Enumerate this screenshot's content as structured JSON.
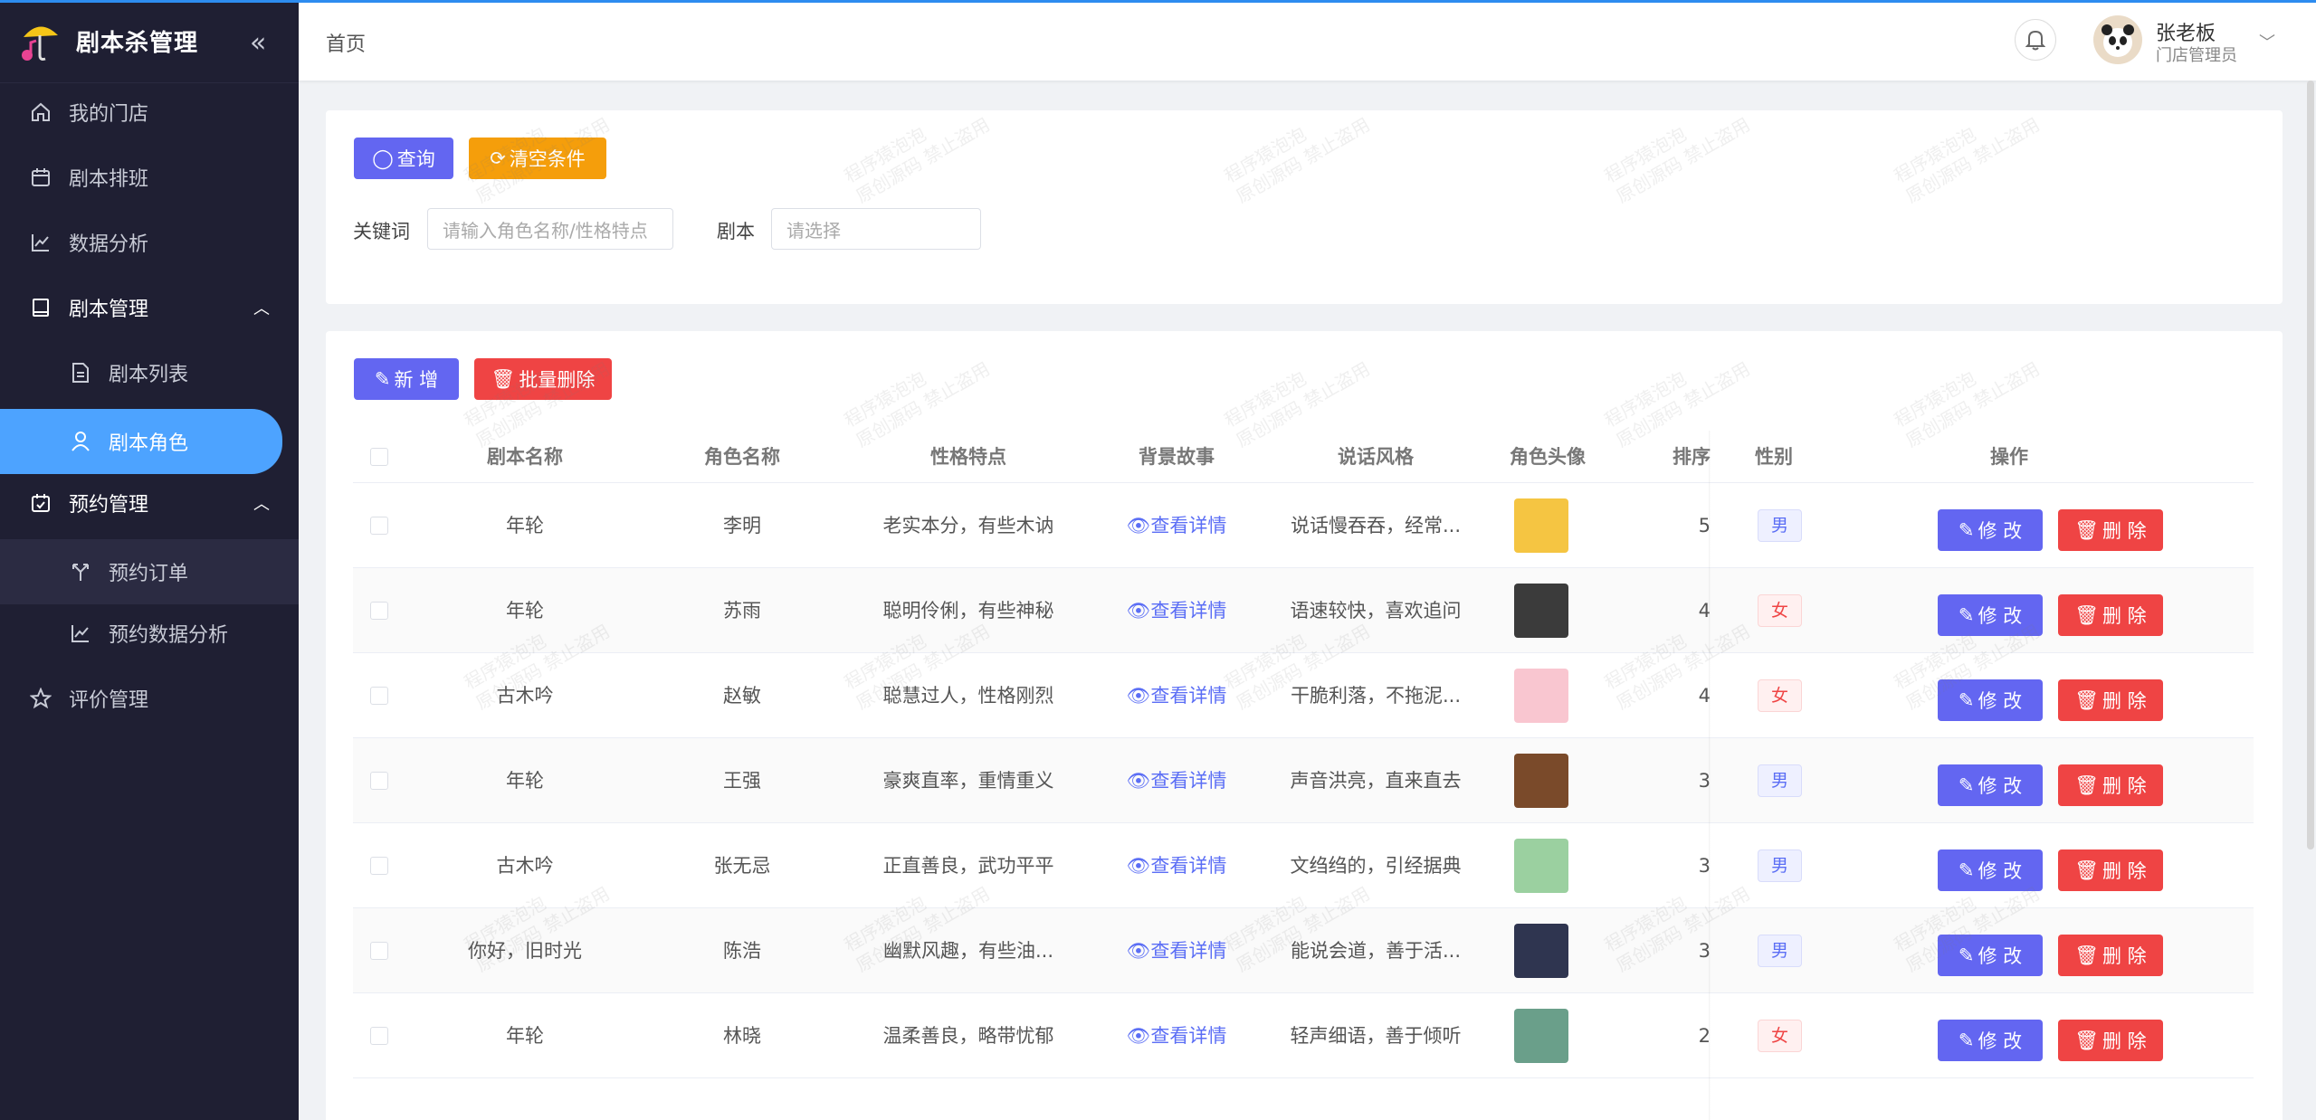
{
  "app": {
    "title": "剧本杀管理"
  },
  "sidebar": {
    "items": [
      {
        "label": "我的门店"
      },
      {
        "label": "剧本排班"
      },
      {
        "label": "数据分析"
      },
      {
        "label": "剧本管理"
      },
      {
        "label": "剧本列表"
      },
      {
        "label": "剧本角色"
      },
      {
        "label": "预约管理"
      },
      {
        "label": "预约订单"
      },
      {
        "label": "预约数据分析"
      },
      {
        "label": "评价管理"
      }
    ]
  },
  "header": {
    "breadcrumb": "首页",
    "user": {
      "name": "张老板",
      "role": "门店管理员"
    }
  },
  "filters": {
    "query_label": "查询",
    "clear_label": "清空条件",
    "keyword_label": "关键词",
    "keyword_placeholder": "请输入角色名称/性格特点",
    "script_label": "剧本",
    "script_placeholder": "请选择"
  },
  "toolbar": {
    "add_label": "新 增",
    "batch_delete_label": "批量删除"
  },
  "table": {
    "columns": [
      "剧本名称",
      "角色名称",
      "性格特点",
      "背景故事",
      "说话风格",
      "角色头像",
      "排序",
      "性别",
      "操作"
    ],
    "view_label": "查看详情",
    "edit_label": "修 改",
    "delete_label": "删 除",
    "rows": [
      {
        "script": "年轮",
        "role": "李明",
        "trait": "老实本分，有些木讷",
        "style": "说话慢吞吞，经常...",
        "order": "5",
        "gender": "男"
      },
      {
        "script": "年轮",
        "role": "苏雨",
        "trait": "聪明伶俐，有些神秘",
        "style": "语速较快，喜欢追问",
        "order": "4",
        "gender": "女"
      },
      {
        "script": "古木吟",
        "role": "赵敏",
        "trait": "聪慧过人，性格刚烈",
        "style": "干脆利落，不拖泥...",
        "order": "4",
        "gender": "女"
      },
      {
        "script": "年轮",
        "role": "王强",
        "trait": "豪爽直率，重情重义",
        "style": "声音洪亮，直来直去",
        "order": "3",
        "gender": "男"
      },
      {
        "script": "古木吟",
        "role": "张无忌",
        "trait": "正直善良，武功平平",
        "style": "文绉绉的，引经据典",
        "order": "3",
        "gender": "男"
      },
      {
        "script": "你好，旧时光",
        "role": "陈浩",
        "trait": "幽默风趣，有些油...",
        "style": "能说会道，善于活...",
        "order": "3",
        "gender": "男"
      },
      {
        "script": "年轮",
        "role": "林晓",
        "trait": "温柔善良，略带忧郁",
        "style": "轻声细语，善于倾听",
        "order": "2",
        "gender": "女"
      }
    ]
  },
  "watermark": {
    "line1": "程序猿泡泡",
    "line2": "原创源码 禁止盗用"
  },
  "colors": {
    "primary": "#6366f1",
    "warning": "#f59e0b",
    "danger": "#ef4444",
    "sidebar": "#1f1f33",
    "active": "#4da3ff"
  }
}
